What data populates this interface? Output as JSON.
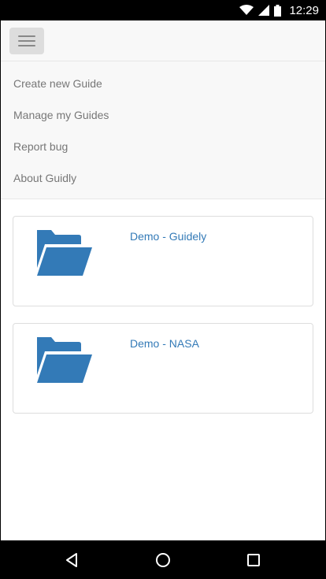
{
  "status_bar": {
    "time": "12:29",
    "icons": [
      "wifi-icon",
      "cell-signal-icon",
      "battery-icon"
    ]
  },
  "navbar": {
    "toggle_icon": "hamburger-menu-icon"
  },
  "menu": {
    "items": [
      {
        "label": "Create new Guide"
      },
      {
        "label": "Manage my Guides"
      },
      {
        "label": "Report bug"
      },
      {
        "label": "About Guidly"
      }
    ]
  },
  "guides": [
    {
      "title": "Demo - Guidely",
      "icon": "folder-open-icon"
    },
    {
      "title": "Demo - NASA",
      "icon": "folder-open-icon"
    }
  ],
  "system_nav": {
    "buttons": [
      "back-icon",
      "home-icon",
      "recents-icon"
    ]
  },
  "colors": {
    "accent": "#337ab7",
    "menu_text": "#777777",
    "navbar_bg": "#f8f8f8",
    "toggle_bg": "#dddddd"
  }
}
